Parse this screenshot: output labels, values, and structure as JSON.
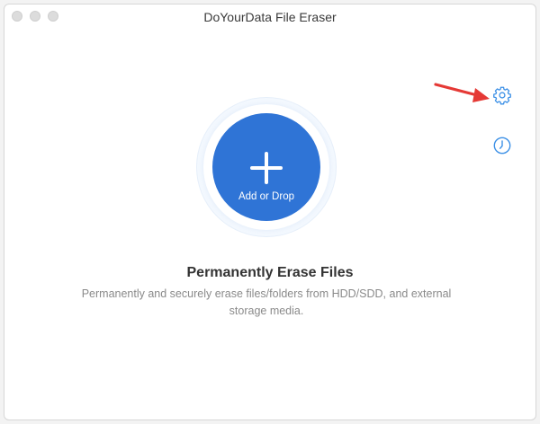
{
  "window": {
    "title": "DoYourData File Eraser"
  },
  "drop_zone": {
    "label": "Add or Drop",
    "icon": "plus-icon"
  },
  "main": {
    "heading": "Permanently Erase Files",
    "description": "Permanently and securely erase files/folders from HDD/SDD, and external storage media."
  },
  "sidebar_icons": {
    "settings": "gear-icon",
    "history": "clock-icon"
  },
  "colors": {
    "accent": "#2f74d6",
    "icon_blue": "#3a8fe6",
    "annotation_red": "#e53935"
  }
}
